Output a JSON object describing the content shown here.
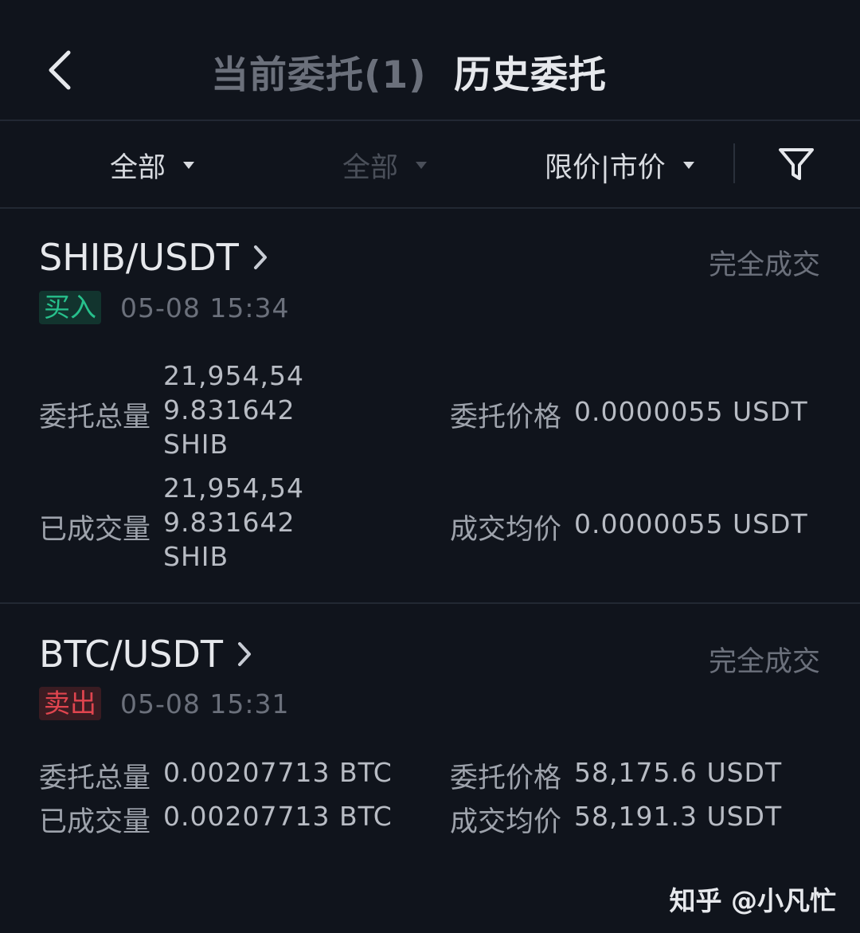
{
  "header": {
    "tab_current": "当前委托(1)",
    "tab_history": "历史委托",
    "active_tab": "历史委托"
  },
  "filters": {
    "filter1": "全部",
    "filter2": "全部",
    "filter3": "限价|市价"
  },
  "orders": [
    {
      "pair": "SHIB/USDT",
      "status": "完全成交",
      "side": "买入",
      "time": "05-08 15:34",
      "qty_label": "委托总量",
      "qty_lines": [
        "21,954,54",
        "9.831642",
        "SHIB"
      ],
      "price_label": "委托价格",
      "price_value": "0.0000055 USDT",
      "filled_label": "已成交量",
      "filled_lines": [
        "21,954,54",
        "9.831642",
        "SHIB"
      ],
      "avg_label": "成交均价",
      "avg_value": "0.0000055 USDT"
    },
    {
      "pair": "BTC/USDT",
      "status": "完全成交",
      "side": "卖出",
      "time": "05-08 15:31",
      "qty_label": "委托总量",
      "qty_value": "0.00207713 BTC",
      "price_label": "委托价格",
      "price_value": "58,175.6 USDT",
      "filled_label": "已成交量",
      "filled_value": "0.00207713 BTC",
      "avg_label": "成交均价",
      "avg_value": "58,191.3 USDT"
    }
  ],
  "watermark": "知乎 @小凡忙",
  "colors": {
    "background": "#10141c",
    "buy": "#27c08c",
    "sell": "#e0454f",
    "muted": "#6b707b"
  },
  "icons": [
    "back-arrow-icon",
    "caret-down-icon",
    "filter-funnel-icon",
    "chevron-right-icon"
  ]
}
